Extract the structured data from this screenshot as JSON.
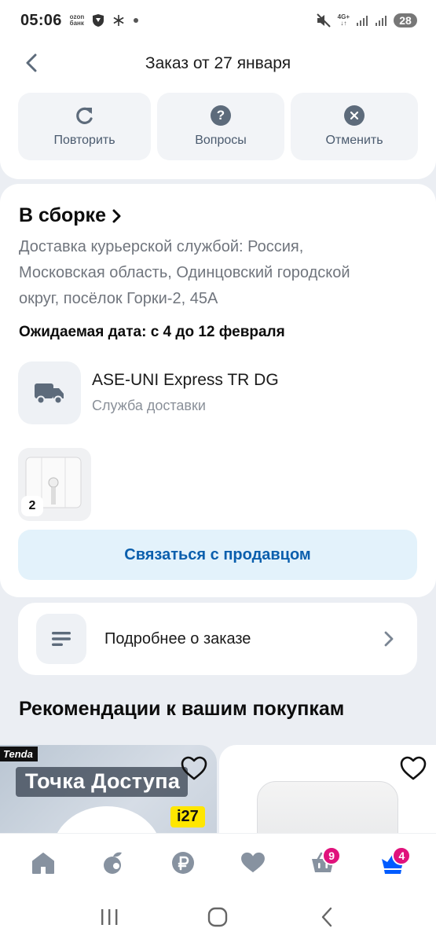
{
  "status_bar": {
    "time": "05:06",
    "ozon_top": "ozon",
    "ozon_bottom": "банк",
    "network": "4G+",
    "battery": "28"
  },
  "header": {
    "title": "Заказ от 27 января"
  },
  "actions": [
    {
      "label": "Повторить",
      "icon": "refresh-icon"
    },
    {
      "label": "Вопросы",
      "icon": "question-icon"
    },
    {
      "label": "Отменить",
      "icon": "close-icon"
    }
  ],
  "order_status": {
    "title": "В сборке",
    "address": "Доставка курьерской службой: Россия, Московская область, Одинцовский городской округ, посёлок Горки-2, 45А",
    "expected_date": "Ожидаемая дата: с 4 до 12 февраля",
    "carrier_name": "ASE-UNI Express TR DG",
    "carrier_sub": "Служба доставки",
    "product_quantity": "2",
    "contact_button": "Связаться с продавцом"
  },
  "details": {
    "label": "Подробнее о заказе"
  },
  "recommendations": {
    "title": "Рекомендации к вашим покупкам",
    "card1_brand": "Tenda",
    "card1_banner": "Точка Доступа",
    "card1_model": "i27"
  },
  "bottom_nav": {
    "items": [
      {
        "icon": "home-icon"
      },
      {
        "icon": "fresh-icon"
      },
      {
        "icon": "ruble-icon"
      },
      {
        "icon": "heart-icon"
      },
      {
        "icon": "cart-icon",
        "badge": "9"
      },
      {
        "icon": "profile-crown-icon",
        "badge": "4"
      }
    ]
  },
  "colors": {
    "accent": "#005bff",
    "badge": "#e0127c",
    "contact_text": "#0b5fad"
  }
}
